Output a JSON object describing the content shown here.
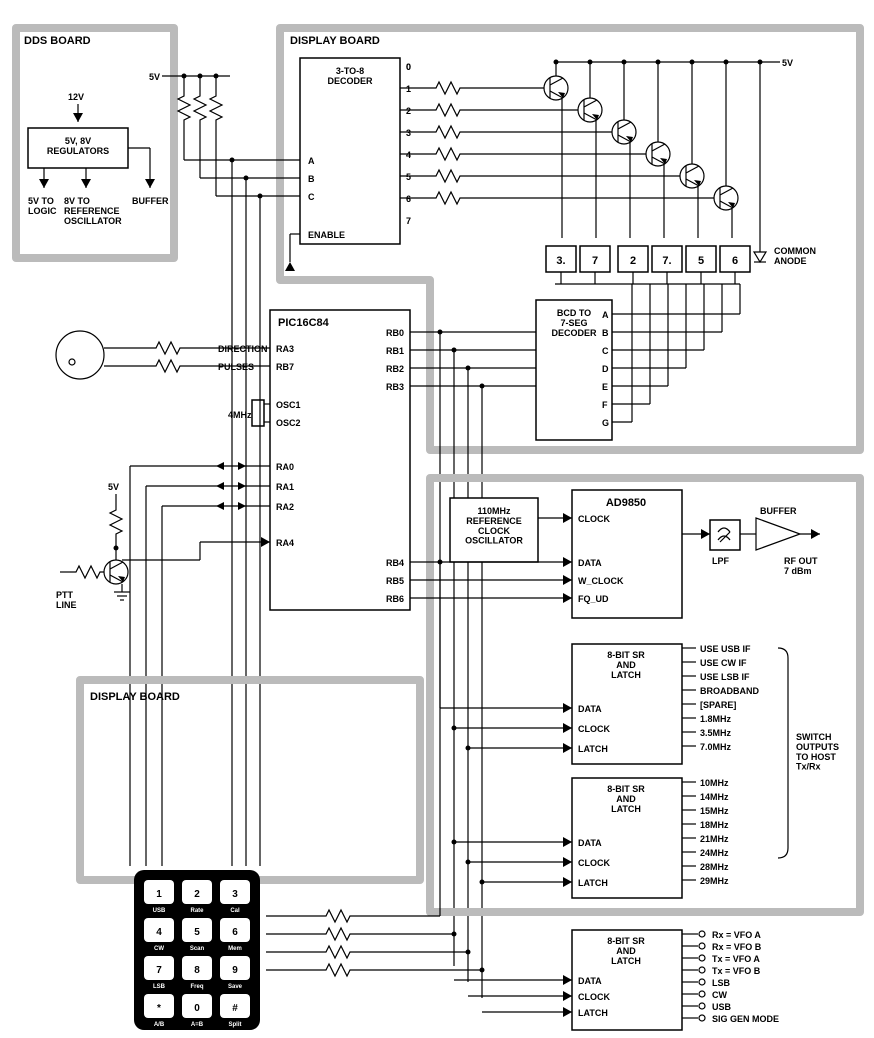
{
  "titles": {
    "dds": "DDS BOARD",
    "display": "DISPLAY BOARD",
    "display2": "DISPLAY BOARD"
  },
  "decoder": {
    "name": "3-TO-8\nDECODER",
    "inA": "A",
    "inB": "B",
    "inC": "C",
    "en": "ENABLE",
    "outs": [
      "0",
      "1",
      "2",
      "3",
      "4",
      "5",
      "6",
      "7"
    ]
  },
  "reg": {
    "label": "5V, 8V\nREGULATORS",
    "in": "12V",
    "outs": [
      "5V TO\nLOGIC",
      "8V TO\nREFERENCE\nOSCILLATOR",
      "BUFFER"
    ]
  },
  "pic": {
    "name": "PIC16C84",
    "dir": "DIRECTION",
    "pulses": "PULSES",
    "osc": "4MHz",
    "osc1": "OSC1",
    "osc2": "OSC2",
    "rbl": [
      "RA3",
      "RB7"
    ],
    "rbr": [
      "RB0",
      "RB1",
      "RB2",
      "RB3",
      "RB4",
      "RB5",
      "RB6"
    ],
    "ral": [
      "RA0",
      "RA1",
      "RA2",
      "RA4"
    ]
  },
  "bcd": {
    "name": "BCD TO\n7-SEG\nDECODER",
    "o": [
      "A",
      "B",
      "C",
      "D",
      "E",
      "F",
      "G"
    ]
  },
  "digits": [
    "3.",
    "7",
    "2",
    "7.",
    "5",
    "6"
  ],
  "anode": "COMMON\nANODE",
  "rails": {
    "v5a": "5V",
    "v5b": "5V",
    "v5c": "5V"
  },
  "ptt": "PTT\nLINE",
  "ad": {
    "name": "AD9850",
    "ref": "110MHz\nREFERENCE\nCLOCK\nOSCILLATOR",
    "pins": [
      "CLOCK",
      "DATA",
      "W_CLOCK",
      "FQ_UD"
    ],
    "lpf": "LPF",
    "buf": "BUFFER",
    "rf": "RF OUT\n7 dBm"
  },
  "sr": {
    "name": "8-BIT SR\nAND\nLATCH",
    "pins": [
      "DATA",
      "CLOCK",
      "LATCH"
    ]
  },
  "sr1out": [
    "USE USB IF",
    "USE CW IF",
    "USE LSB IF",
    "BROADBAND",
    "[SPARE]",
    "1.8MHz",
    "3.5MHz",
    "7.0MHz"
  ],
  "sr2out": [
    "10MHz",
    "14MHz",
    "15MHz",
    "18MHz",
    "21MHz",
    "24MHz",
    "28MHz",
    "29MHz"
  ],
  "switch": "SWITCH\nOUTPUTS\nTO HOST\nTx/Rx",
  "sr3out": [
    "Rx = VFO A",
    "Rx = VFO B",
    "Tx = VFO A",
    "Tx = VFO B",
    "LSB",
    "CW",
    "USB",
    "SIG GEN MODE"
  ],
  "keypad": {
    "r0": [
      {
        "n": "1",
        "s": "USB"
      },
      {
        "n": "2",
        "s": "Rate"
      },
      {
        "n": "3",
        "s": "Cal"
      }
    ],
    "r1": [
      {
        "n": "4",
        "s": "CW"
      },
      {
        "n": "5",
        "s": "Scan"
      },
      {
        "n": "6",
        "s": "Mem"
      }
    ],
    "r2": [
      {
        "n": "7",
        "s": "LSB"
      },
      {
        "n": "8",
        "s": "Freq"
      },
      {
        "n": "9",
        "s": "Save"
      }
    ],
    "r3": [
      {
        "n": "*",
        "s": "A/B"
      },
      {
        "n": "0",
        "s": "A=B"
      },
      {
        "n": "#",
        "s": "Split"
      }
    ]
  },
  "_symbols": {
    "resistor": "zigzag",
    "transistor": "NPN",
    "diode": "triangle-bar",
    "ground": "3-bar",
    "arrow": "filled-triangle",
    "encoder": "rotary-circle",
    "keypad": "4x3"
  }
}
